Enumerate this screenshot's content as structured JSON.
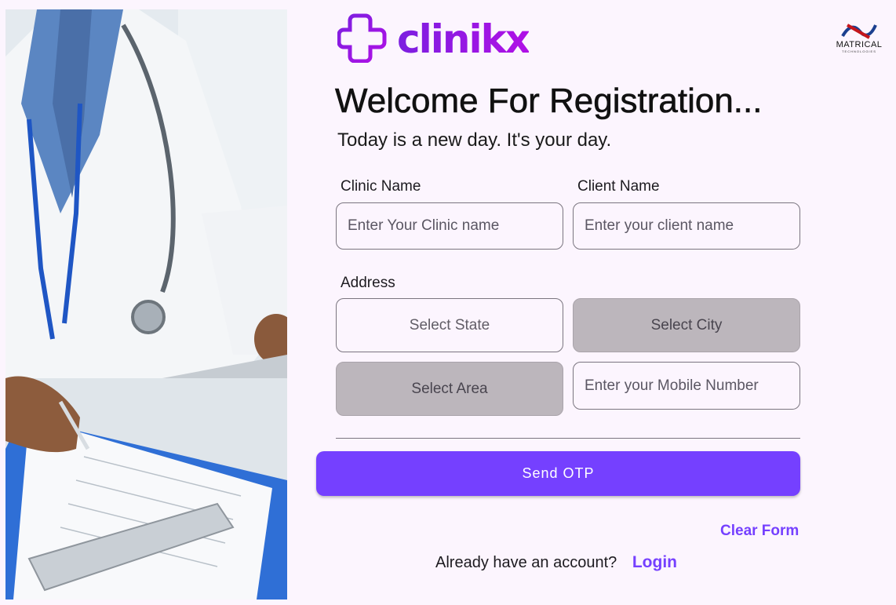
{
  "brand": {
    "name": "clinikx",
    "accent": "#7540ff",
    "logo_gradient": [
      "#7b1fe0",
      "#b010e6"
    ]
  },
  "partner": {
    "name": "MATRICAL",
    "sub": "TECHNOLOGIES"
  },
  "hero": {
    "image": "doctor-writing-on-clipboard"
  },
  "heading": {
    "title": "Welcome For Registration...",
    "subtitle": "Today is a new day. It's your day."
  },
  "form": {
    "clinic_name": {
      "label": "Clinic Name",
      "placeholder": "Enter Your Clinic name",
      "value": ""
    },
    "client_name": {
      "label": "Client Name",
      "placeholder": "Enter your client name",
      "value": ""
    },
    "address_label": "Address",
    "state": {
      "label": "Select State",
      "enabled": true
    },
    "city": {
      "label": "Select City",
      "enabled": false
    },
    "area": {
      "label": "Select Area",
      "enabled": false
    },
    "mobile": {
      "placeholder": "Enter your Mobile Number",
      "value": ""
    }
  },
  "actions": {
    "send_otp": "Send OTP",
    "clear_form": "Clear Form",
    "have_account": "Already have an account?",
    "login": "Login"
  }
}
